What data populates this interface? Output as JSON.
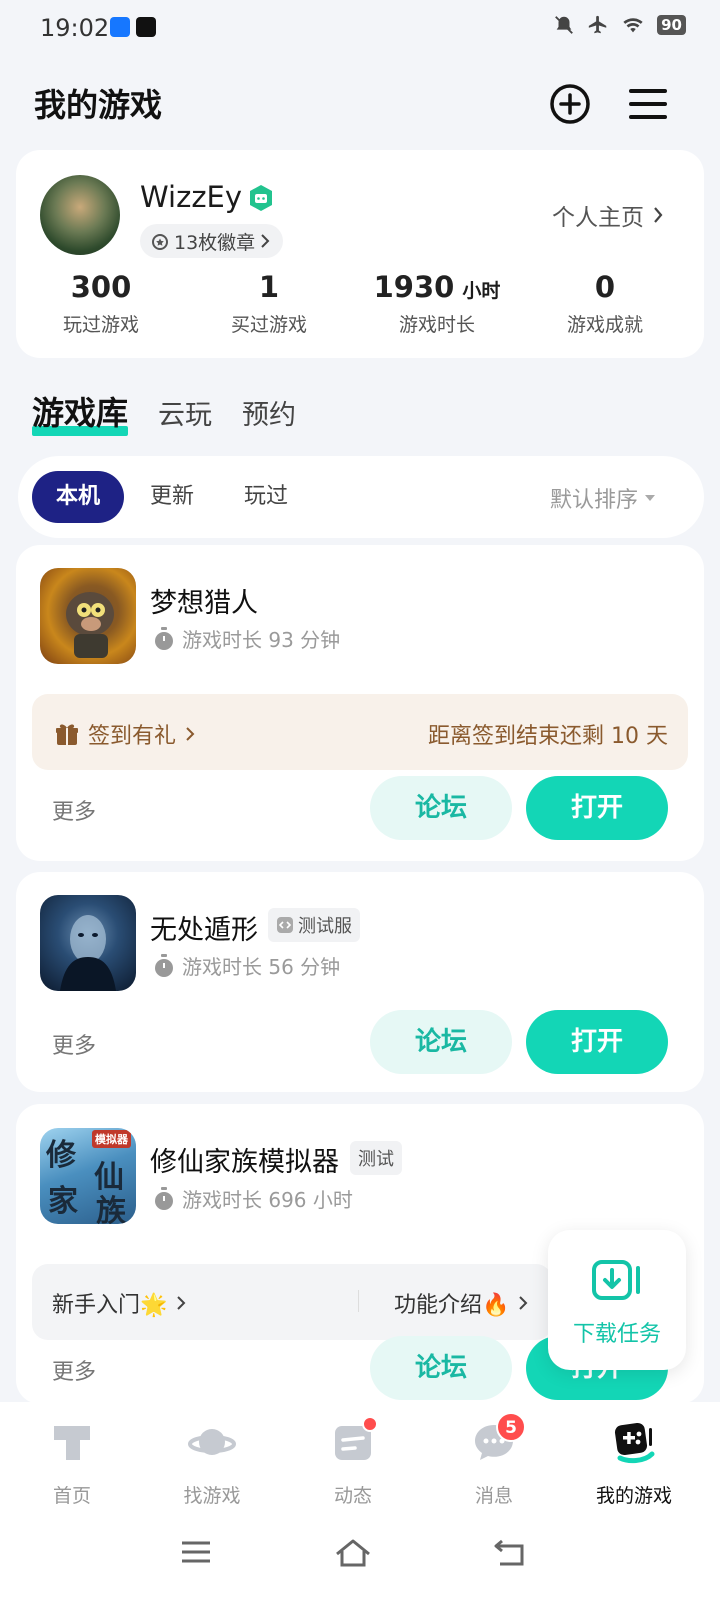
{
  "status_bar": {
    "time": "19:02",
    "battery": "90"
  },
  "header": {
    "title": "我的游戏"
  },
  "profile": {
    "username": "WizzEy",
    "badges": "13枚徽章",
    "homepage_link": "个人主页",
    "stats": [
      {
        "value": "300",
        "unit": "",
        "label": "玩过游戏"
      },
      {
        "value": "1",
        "unit": "",
        "label": "买过游戏"
      },
      {
        "value": "1930",
        "unit": "小时",
        "label": "游戏时长"
      },
      {
        "value": "0",
        "unit": "",
        "label": "游戏成就"
      }
    ]
  },
  "library_tabs": [
    "游戏库",
    "云玩",
    "预约"
  ],
  "filters": {
    "chips": [
      "本机",
      "更新",
      "玩过"
    ],
    "sort": "默认排序"
  },
  "games": [
    {
      "title": "梦想猎人",
      "playtime": "游戏时长 93 分钟",
      "tag": "",
      "more": "更多",
      "forum": "论坛",
      "open": "打开",
      "signin": {
        "left": "签到有礼",
        "right": "距离签到结束还剩 10 天"
      }
    },
    {
      "title": "无处遁形",
      "playtime": "游戏时长 56 分钟",
      "tag": "测试服",
      "more": "更多",
      "forum": "论坛",
      "open": "打开"
    },
    {
      "title": "修仙家族模拟器",
      "playtime": "游戏时长 696 小时",
      "tag": "测试",
      "more": "更多",
      "forum": "论坛",
      "open": "打开",
      "guide": {
        "left": "新手入门🌟",
        "right": "功能介绍🔥"
      },
      "icon_text": [
        "修",
        "仙",
        "家",
        "族",
        "模拟器"
      ]
    }
  ],
  "download_float": {
    "label": "下载任务"
  },
  "bottom_nav": {
    "items": [
      {
        "label": "首页",
        "icon": "home-t-icon"
      },
      {
        "label": "找游戏",
        "icon": "planet-icon"
      },
      {
        "label": "动态",
        "icon": "feed-icon"
      },
      {
        "label": "消息",
        "icon": "chat-icon",
        "badge": "5"
      },
      {
        "label": "我的游戏",
        "icon": "gamepad-icon"
      }
    ]
  },
  "colors": {
    "accent": "#13d6b6",
    "chip_active": "#1e2285",
    "signin_text": "#8a5a2e",
    "badge": "#ff4d4d"
  }
}
